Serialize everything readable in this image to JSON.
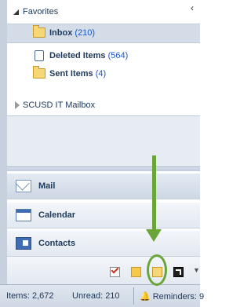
{
  "favorites": {
    "header": "Favorites",
    "collapse_glyph": "‹",
    "items": [
      {
        "name": "Inbox",
        "count": "(210)",
        "icon": "folder-icon"
      },
      {
        "name": "Deleted Items",
        "count": "(564)",
        "icon": "trash-icon"
      },
      {
        "name": "Sent Items",
        "count": "(4)",
        "icon": "sent-folder-icon"
      }
    ]
  },
  "mailbox": {
    "label": "SCUSD IT Mailbox"
  },
  "navigation": {
    "mail": "Mail",
    "calendar": "Calendar",
    "contacts": "Contacts"
  },
  "statusbar": {
    "items": "Items: 2,672",
    "unread": "Unread: 210",
    "reminders": "Reminders: 9",
    "bell": "🔔"
  },
  "colors": {
    "annotation": "#6aa539",
    "selected": "#d4dce8",
    "count_link": "#1a56c8"
  }
}
